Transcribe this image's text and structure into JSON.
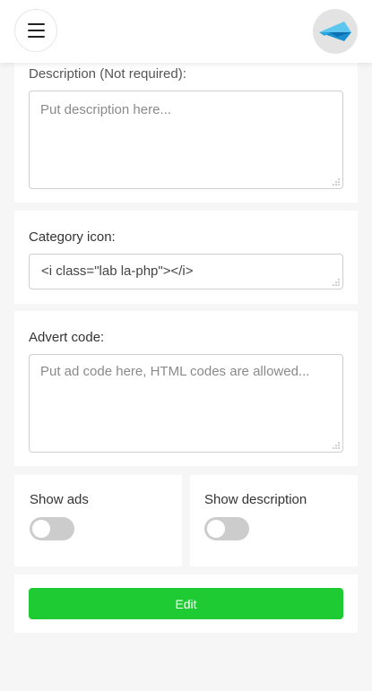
{
  "header": {
    "menu_icon": "hamburger-menu-icon",
    "logo_icon": "paper-plane-logo"
  },
  "description": {
    "label": "Description (Not required):",
    "placeholder": "Put description here..."
  },
  "category_icon": {
    "label": "Category icon:",
    "value": "<i class=\"lab la-php\"></i>"
  },
  "advert_code": {
    "label": "Advert code:",
    "placeholder": "Put ad code here, HTML codes are allowed..."
  },
  "toggles": {
    "show_ads_label": "Show ads",
    "show_ads_on": false,
    "show_description_label": "Show description",
    "show_description_on": false
  },
  "actions": {
    "edit_label": "Edit"
  },
  "colors": {
    "accent_green": "#1ecb32",
    "logo_blue": "#1a9ad6"
  }
}
